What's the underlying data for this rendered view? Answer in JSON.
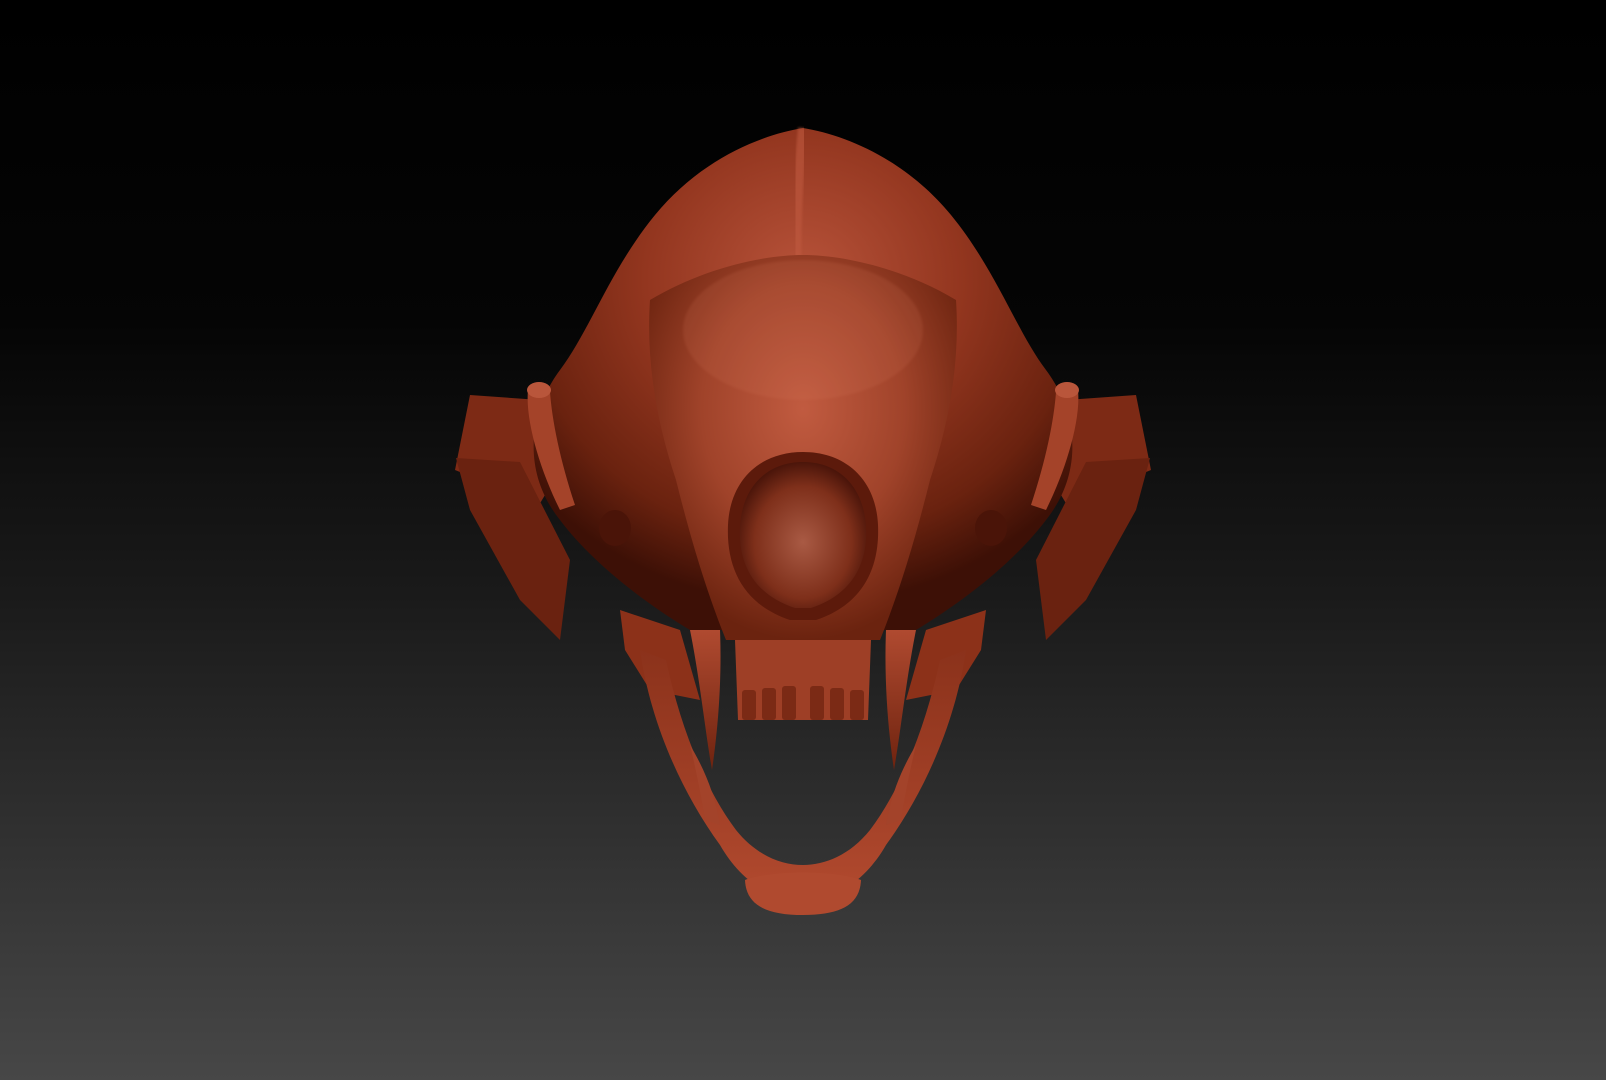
{
  "scene": {
    "subject": "sculpted-skull-model",
    "colors": {
      "background_top": "#000000",
      "background_bottom": "#474747",
      "material_base": "#8a2f1c",
      "material_highlight": "#c5573c",
      "material_shadow": "#3a0e06"
    }
  }
}
